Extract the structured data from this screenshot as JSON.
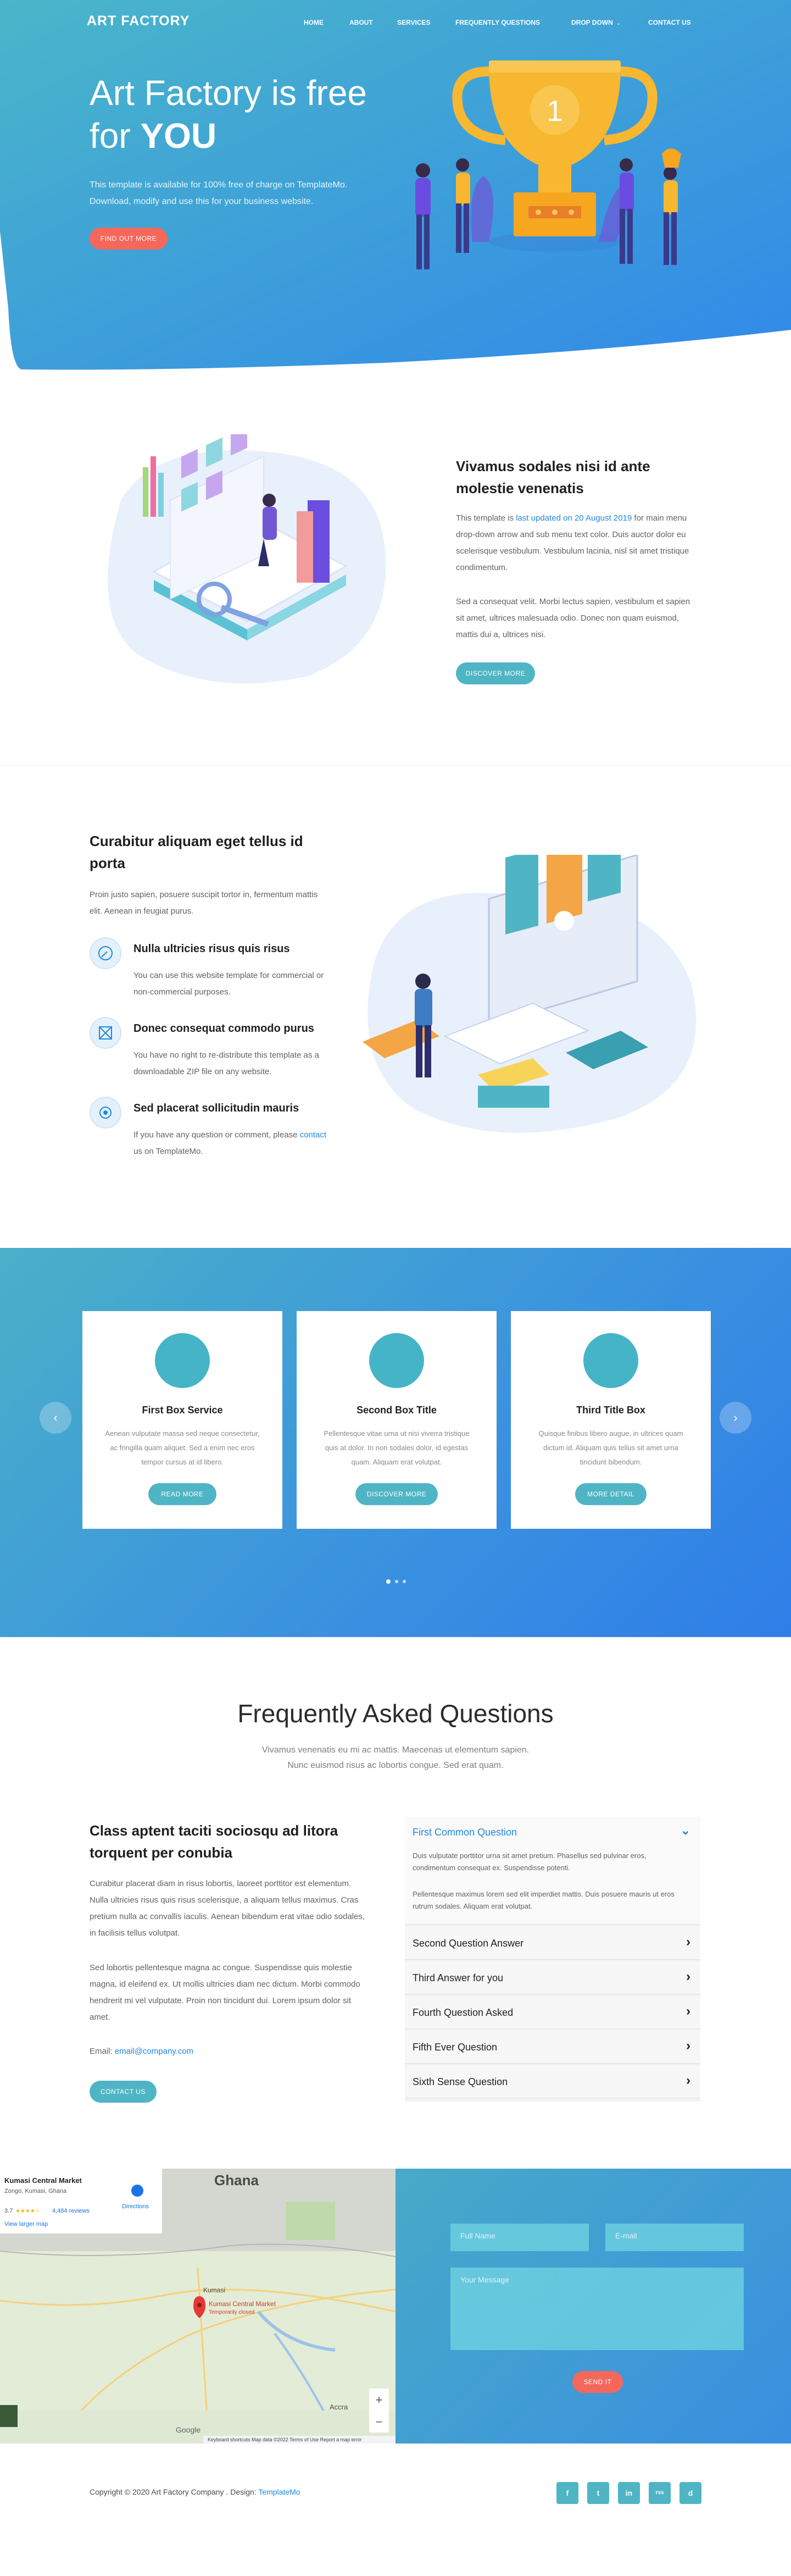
{
  "brand": {
    "logo": "ART FACTORY"
  },
  "nav": {
    "items": [
      "HOME",
      "ABOUT",
      "SERVICES",
      "FREQUENTLY QUESTIONS",
      "DROP DOWN",
      "CONTACT US"
    ]
  },
  "hero": {
    "title_line1": "Art Factory is free",
    "title_line2_prefix": "for ",
    "title_line2_bold": "YOU",
    "subtitle_line1": "This template is available for 100% free of charge on TemplateMo.",
    "subtitle_line2": "Download, modify and use this for your business website.",
    "button": "FIND OUT MORE",
    "trophy_number": "1"
  },
  "about": {
    "title": "Vivamus sodales nisi id ante molestie venenatis",
    "para1_prefix": "This template is ",
    "para1_link": "last updated on 20 August 2019",
    "para1_suffix": " for main menu drop-down arrow and sub menu text color. Duis auctor dolor eu scelerisque vestibulum. Vestibulum lacinia, nisl sit amet tristique condimentum.",
    "para2": "Sed a consequat velit. Morbi lectus sapien, vestibulum et sapien sit amet, ultrices malesuada odio. Donec non quam euismod, mattis dui a, ultrices nisi.",
    "button": "DISCOVER MORE"
  },
  "features": {
    "title": "Curabitur aliquam eget tellus id porta",
    "intro": "Proin justo sapien, posuere suscipit tortor in, fermentum mattis elit. Aenean in feugiat purus.",
    "items": [
      {
        "title": "Nulla ultricies risus quis risus",
        "text": "You can use this website template for commercial or non-commercial purposes."
      },
      {
        "title": "Donec consequat commodo purus",
        "text": "You have no right to re-distribute this template as a downloadable ZIP file on any website."
      },
      {
        "title": "Sed placerat sollicitudin mauris",
        "text_prefix": "If you have any question or comment, please ",
        "text_link": "contact",
        "text_suffix": " us on TemplateMo."
      }
    ]
  },
  "services": {
    "cards": [
      {
        "title": "First Box Service",
        "text": "Aenean vulputate massa sed neque consectetur, ac fringilla quam aliquet. Sed a enim nec eros tempor cursus at id libero.",
        "button": "READ MORE"
      },
      {
        "title": "Second Box Title",
        "text": "Pellentesque vitae urna ut nisi viverra tristique quis at dolor. In non sodales dolor, id egestas quam. Aliquam erat volutpat.",
        "button": "DISCOVER MORE"
      },
      {
        "title": "Third Title Box",
        "text": "Quisque finibus libero augue, in ultrices quam dictum id. Aliquam quis tellus sit amet urna tincidunt bibendum.",
        "button": "MORE DETAIL"
      }
    ],
    "prev": "‹",
    "next": "›"
  },
  "faq": {
    "title": "Frequently Asked Questions",
    "subtitle_line1": "Vivamus venenatis eu mi ac mattis. Maecenas ut elementum sapien.",
    "subtitle_line2": "Nunc euismod risus ac lobortis congue. Sed erat quam.",
    "left_title": "Class aptent taciti sociosqu ad litora torquent per conubia",
    "left_para1": "Curabitur placerat diam in risus lobortis, laoreet porttitor est elementum. Nulla ultricies risus quis risus scelerisque, a aliquam tellus maximus. Cras pretium nulla ac convallis iaculis. Aenean bibendum erat vitae odio sodales, in facilisis tellus volutpat.",
    "left_para2": "Sed lobortis pellentesque magna ac congue. Suspendisse quis molestie magna, id eleifend ex. Ut mollis ultricies diam nec dictum. Morbi commodo hendrerit mi vel vulputate. Proin non tincidunt dui. Lorem ipsum dolor sit amet.",
    "email_label": "Email: ",
    "email": "email@company.com",
    "button": "CONTACT US",
    "open_question": "First Common Question",
    "open_answer1": "Duis vulputate porttitor urna sit amet pretium. Phasellus sed pulvinar eros, condimentum consequat ex. Suspendisse potenti.",
    "open_answer2": "Pellentesque maximus lorem sed elit imperdiet mattis. Duis posuere mauris ut eros rutrum sodales. Aliquam erat volutpat.",
    "questions": [
      "Second Question Answer",
      "Third Answer for you",
      "Fourth Question Asked",
      "Fifth Ever Question",
      "Sixth Sense Question"
    ]
  },
  "map": {
    "place": "Kumasi Central Market",
    "address": "Zongo, Kumasi, Ghana",
    "rating": "3.7",
    "stars": "★★★★☆",
    "reviews": "4,484 reviews",
    "directions": "Directions",
    "larger": "View larger map",
    "country": "Ghana",
    "pin_label": "Kumasi Central Market",
    "pin_sub": "Temporarily closed",
    "city1": "Kumasi",
    "city2": "Accra",
    "footer": "Keyboard shortcuts   Map data ©2022   Terms of Use   Report a map error",
    "google": "Google"
  },
  "contact": {
    "name_placeholder": "Full Name",
    "email_placeholder": "E-mail",
    "message_placeholder": "Your Message",
    "button": "SEND IT"
  },
  "footer": {
    "copy_prefix": "Copyright © 2020 Art Factory Company . Design: ",
    "copy_link": "TemplateMo",
    "social": [
      "f",
      "t",
      "in",
      "rss",
      "d"
    ]
  },
  "colors": {
    "accent": "#4fb5c4",
    "hero_start": "#4ab6c9",
    "hero_end": "#3189e9",
    "button_red": "#f4685b"
  }
}
